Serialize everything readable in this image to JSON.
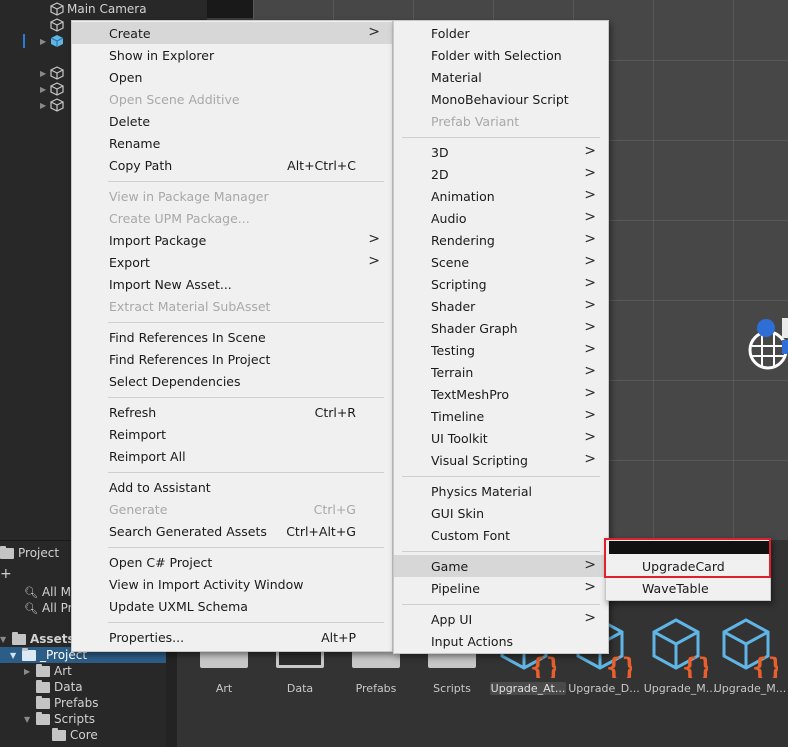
{
  "hierarchy": {
    "items": [
      {
        "label": "Main Camera"
      }
    ]
  },
  "project": {
    "tab_label": "Project",
    "plus": "+",
    "tree": [
      {
        "label": "All Mo"
      },
      {
        "label": "All Pre"
      },
      {
        "label": "Assets"
      },
      {
        "label": "_Project"
      },
      {
        "label": "Art"
      },
      {
        "label": "Data"
      },
      {
        "label": "Prefabs"
      },
      {
        "label": "Scripts"
      },
      {
        "label": "Core"
      }
    ],
    "assets": [
      {
        "name": "Art"
      },
      {
        "name": "Data"
      },
      {
        "name": "Prefabs"
      },
      {
        "name": "Scripts"
      },
      {
        "name": "Upgrade_At..."
      },
      {
        "name": "Upgrade_D..."
      },
      {
        "name": "Upgrade_M..."
      },
      {
        "name": "Upgrade_M..."
      }
    ]
  },
  "menu1": {
    "items": [
      {
        "label": "Create",
        "submenu": ">"
      },
      {
        "label": "Show in Explorer"
      },
      {
        "label": "Open"
      },
      {
        "label": "Open Scene Additive"
      },
      {
        "label": "Delete"
      },
      {
        "label": "Rename"
      },
      {
        "label": "Copy Path",
        "shortcut": "Alt+Ctrl+C"
      },
      {
        "label": "View in Package Manager"
      },
      {
        "label": "Create UPM Package..."
      },
      {
        "label": "Import Package",
        "submenu": ">"
      },
      {
        "label": "Export",
        "submenu": ">"
      },
      {
        "label": "Import New Asset..."
      },
      {
        "label": "Extract Material SubAsset"
      },
      {
        "label": "Find References In Scene"
      },
      {
        "label": "Find References In Project"
      },
      {
        "label": "Select Dependencies"
      },
      {
        "label": "Refresh",
        "shortcut": "Ctrl+R"
      },
      {
        "label": "Reimport"
      },
      {
        "label": "Reimport All"
      },
      {
        "label": "Add to Assistant"
      },
      {
        "label": "Generate",
        "shortcut": "Ctrl+G"
      },
      {
        "label": "Search Generated Assets",
        "shortcut": "Ctrl+Alt+G"
      },
      {
        "label": "Open C# Project"
      },
      {
        "label": "View in Import Activity Window"
      },
      {
        "label": "Update UXML Schema"
      },
      {
        "label": "Properties...",
        "shortcut": "Alt+P"
      }
    ]
  },
  "menu2": {
    "items": [
      {
        "label": "Folder"
      },
      {
        "label": "Folder with Selection"
      },
      {
        "label": "Material"
      },
      {
        "label": "MonoBehaviour Script"
      },
      {
        "label": "Prefab Variant"
      },
      {
        "label": "3D",
        "submenu": ">"
      },
      {
        "label": "2D",
        "submenu": ">"
      },
      {
        "label": "Animation",
        "submenu": ">"
      },
      {
        "label": "Audio",
        "submenu": ">"
      },
      {
        "label": "Rendering",
        "submenu": ">"
      },
      {
        "label": "Scene",
        "submenu": ">"
      },
      {
        "label": "Scripting",
        "submenu": ">"
      },
      {
        "label": "Shader",
        "submenu": ">"
      },
      {
        "label": "Shader Graph",
        "submenu": ">"
      },
      {
        "label": "Testing",
        "submenu": ">"
      },
      {
        "label": "Terrain",
        "submenu": ">"
      },
      {
        "label": "TextMeshPro",
        "submenu": ">"
      },
      {
        "label": "Timeline",
        "submenu": ">"
      },
      {
        "label": "UI Toolkit",
        "submenu": ">"
      },
      {
        "label": "Visual Scripting",
        "submenu": ">"
      },
      {
        "label": "Physics Material"
      },
      {
        "label": "GUI Skin"
      },
      {
        "label": "Custom Font"
      },
      {
        "label": "Game",
        "submenu": ">"
      },
      {
        "label": "Pipeline",
        "submenu": ">"
      },
      {
        "label": "App UI",
        "submenu": ">"
      },
      {
        "label": "Input Actions"
      }
    ]
  },
  "menu3": {
    "items": [
      {
        "label": "UpgradeCard"
      },
      {
        "label": "WaveTable"
      }
    ]
  },
  "colors": {
    "highlight_box": "#e0202a",
    "script_icon_blue": "#5fb6e6",
    "script_icon_orange": "#e8602c",
    "selection_blue": "#2c5d87"
  }
}
